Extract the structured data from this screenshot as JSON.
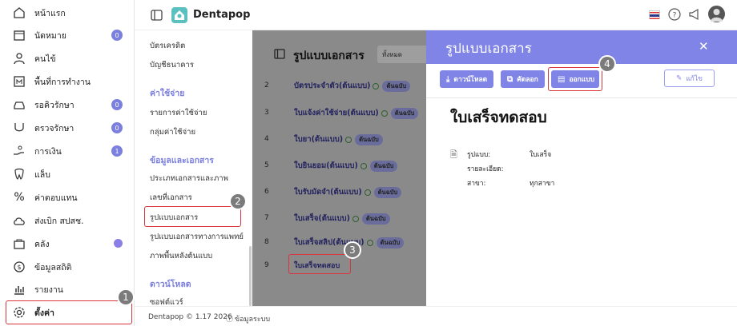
{
  "nav": {
    "items": [
      {
        "label": "หน้าแรก",
        "icon": "home-icon"
      },
      {
        "label": "นัดหมาย",
        "icon": "calendar-icon",
        "badge": "0"
      },
      {
        "label": "คนไข้",
        "icon": "user-icon"
      },
      {
        "label": "พื้นที่การทำงาน",
        "icon": "workspace-icon"
      },
      {
        "label": "รอคิวรักษา",
        "icon": "car-icon",
        "badge": "0"
      },
      {
        "label": "ตรวจรักษา",
        "icon": "treatment-icon",
        "badge": "0"
      },
      {
        "label": "การเงิน",
        "icon": "hand-money-icon",
        "badge": "1"
      },
      {
        "label": "แล็บ",
        "icon": "tooth-icon"
      },
      {
        "label": "ค่าตอบแทน",
        "icon": "percent-icon"
      },
      {
        "label": "ส่งเบิก สปสช.",
        "icon": "cloud-icon"
      },
      {
        "label": "คลัง",
        "icon": "box-icon"
      },
      {
        "label": "ข้อมูลสถิติ",
        "icon": "stats-icon"
      },
      {
        "label": "รายงาน",
        "icon": "report-icon"
      },
      {
        "label": "ตั้งค่า",
        "icon": "gear-icon"
      }
    ]
  },
  "settings_menu": {
    "items": [
      "บัตรเครดิต",
      "บัญชีธนาคาร"
    ],
    "expense_header": "ค่าใช้จ่าย",
    "expense_items": [
      "รายการค่าใช้จ่าย",
      "กลุ่มค่าใช้จ่าย"
    ],
    "docs_header": "ข้อมูลและเอกสาร",
    "docs_items": [
      "ประเภทเอกสารและภาพ",
      "เลขที่เอกสาร",
      "รูปแบบเอกสาร",
      "รูปแบบเอกสารทางการแพทย์",
      "ภาพพื้นหลังต้นแบบ"
    ],
    "download_header": "ดาวน์โหลด",
    "download_items": [
      "ซอฟต์แวร์"
    ]
  },
  "topbar": {
    "brand": "Dentapop"
  },
  "list": {
    "title": "รูปแบบเอกสาร",
    "filter_value": "ทั้งหมด",
    "rows": [
      {
        "num": "2",
        "name": "บัตรประจำตัว(ต้นแบบ)",
        "tag": "ต้นฉบับ"
      },
      {
        "num": "3",
        "name": "ใบแจ้งค่าใช้จ่าย(ต้นแบบ)",
        "tag": "ต้นฉบับ"
      },
      {
        "num": "4",
        "name": "ใบยา(ต้นแบบ)",
        "tag": "ต้นฉบับ"
      },
      {
        "num": "5",
        "name": "ใบยินยอม(ต้นแบบ)",
        "tag": "ต้นฉบับ"
      },
      {
        "num": "6",
        "name": "ใบรับมัดจำ(ต้นแบบ)",
        "tag": "ต้นฉบับ"
      },
      {
        "num": "7",
        "name": "ใบเสร็จ(ต้นแบบ)",
        "tag": "ต้นฉบับ"
      },
      {
        "num": "8",
        "name": "ใบเสร็จสลิป(ต้นแบบ)",
        "tag": "ต้นฉบับ"
      },
      {
        "num": "9",
        "name": "ใบเสร็จทดสอบ",
        "tag": ""
      }
    ]
  },
  "panel": {
    "header": "รูปแบบเอกสาร",
    "buttons": {
      "download": "ดาวน์โหลด",
      "copy": "คัดลอก",
      "design": "ออกแบบ",
      "edit": "แก้ไข"
    },
    "doc_title": "ใบเสร็จทดสอบ",
    "fields": [
      {
        "label": "รูปแบบ:",
        "value": "ใบเสร็จ"
      },
      {
        "label": "รายละเอียด:",
        "value": ""
      },
      {
        "label": "สาขา:",
        "value": "ทุกสาขา"
      }
    ]
  },
  "steps": [
    "1",
    "2",
    "3",
    "4"
  ],
  "footer": {
    "version": "Dentapop © 1.17 2026",
    "system": "ข้อมูลระบบ"
  },
  "colors": {
    "accent": "#7f84e6",
    "highlight": "#d9363e"
  }
}
